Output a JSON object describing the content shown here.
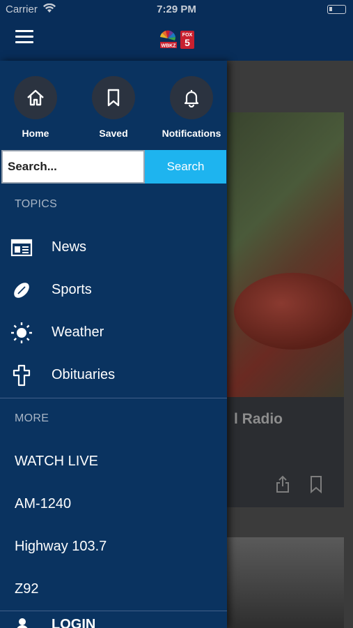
{
  "status_bar": {
    "carrier": "Carrier",
    "time": "7:29 PM"
  },
  "header": {
    "menu_icon": "hamburger-menu-icon",
    "logo": "nbc-fox5-logo"
  },
  "drawer": {
    "quick_actions": [
      {
        "label": "Home",
        "icon": "home-icon"
      },
      {
        "label": "Saved",
        "icon": "bookmark-icon"
      },
      {
        "label": "Notifications",
        "icon": "bell-icon"
      }
    ],
    "search": {
      "placeholder": "Search...",
      "button_label": "Search"
    },
    "topics_heading": "TOPICS",
    "topics": [
      {
        "label": "News",
        "icon": "newspaper-icon"
      },
      {
        "label": "Sports",
        "icon": "football-icon"
      },
      {
        "label": "Weather",
        "icon": "sun-icon"
      },
      {
        "label": "Obituaries",
        "icon": "cross-icon"
      }
    ],
    "more_heading": "MORE",
    "more_items": [
      "WATCH LIVE",
      "AM-1240",
      "Highway 103.7",
      "Z92"
    ],
    "login_label": "LOGIN"
  },
  "background": {
    "card_title": "l Radio"
  },
  "colors": {
    "nav_bg": "#082d59",
    "drawer_bg": "#0a3360",
    "search_button": "#1eb4ef",
    "icon_circle": "#2b3340"
  }
}
